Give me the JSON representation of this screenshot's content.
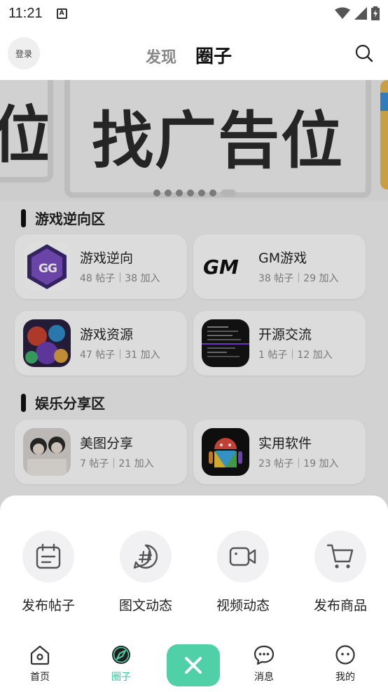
{
  "status": {
    "time": "11:21",
    "notif_badge": "A"
  },
  "header": {
    "login": "登录",
    "tab_discover": "发现",
    "tab_circle": "圈子"
  },
  "banner": {
    "text": "找广告位",
    "left_text": "位"
  },
  "sections": [
    {
      "title": "游戏逆向区",
      "items": [
        {
          "name": "游戏逆向",
          "stats": "48 帖子｜38 加入",
          "icon": "gg-icon"
        },
        {
          "name": "GM游戏",
          "stats": "38 帖子｜29 加入",
          "icon": "gm-icon"
        },
        {
          "name": "游戏资源",
          "stats": "47 帖子｜31 加入",
          "icon": "game-art-icon"
        },
        {
          "name": "开源交流",
          "stats": "1 帖子｜12 加入",
          "icon": "terminal-icon"
        }
      ]
    },
    {
      "title": "娱乐分享区",
      "items": [
        {
          "name": "美图分享",
          "stats": "7 帖子｜21 加入",
          "icon": "photo-icon"
        },
        {
          "name": "实用软件",
          "stats": "23 帖子｜19 加入",
          "icon": "android-icon"
        }
      ]
    }
  ],
  "sheet": {
    "actions": [
      "发布帖子",
      "图文动态",
      "视频动态",
      "发布商品"
    ]
  },
  "nav": {
    "home": "首页",
    "circle": "圈子",
    "messages": "消息",
    "mine": "我的"
  },
  "colors": {
    "accent": "#4fd0a7",
    "accent_text": "#3cc49b"
  }
}
